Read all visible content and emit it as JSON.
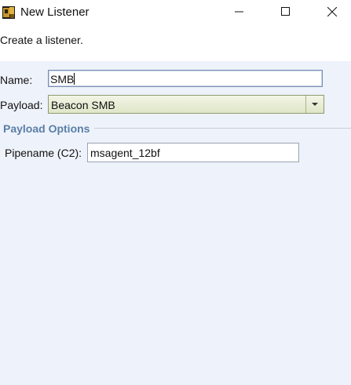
{
  "window": {
    "title": "New Listener",
    "icon": "cobalt-strike-app-icon",
    "controls": {
      "minimize_icon": "minimize-icon",
      "maximize_icon": "maximize-icon",
      "close_icon": "close-icon"
    }
  },
  "header": {
    "description": "Create a listener."
  },
  "form": {
    "name_label": "Name:",
    "name_value": "SMB",
    "payload_label": "Payload:",
    "payload_value": "Beacon SMB"
  },
  "payload_options": {
    "section_title": "Payload Options",
    "pipename_label": "Pipename (C2):",
    "pipename_value": "msagent_12bf"
  },
  "colors": {
    "background": "#eef2fb",
    "section_title": "#5a7fa6",
    "select_fill": "#e4eacf"
  }
}
